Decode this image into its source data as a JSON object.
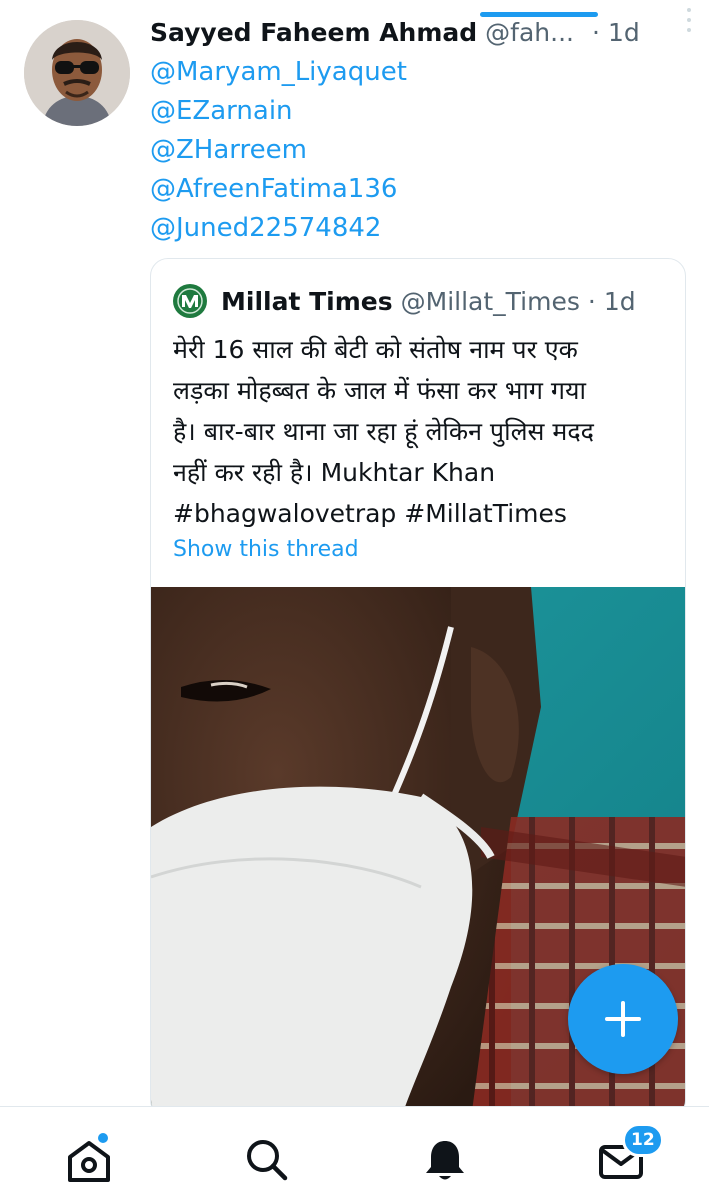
{
  "tweet": {
    "author_name": "Sayyed Faheem Ahmad",
    "author_handle": "@fah...",
    "separator": "·",
    "time": "1d",
    "mentions": [
      "@Maryam_Liyaquet",
      "@EZarnain",
      "@ZHarreem",
      "@AfreenFatima136",
      "@Juned22574842"
    ]
  },
  "quote": {
    "author_name": "Millat Times",
    "author_handle": "@Millat_Times",
    "separator": "·",
    "time": "1d",
    "text": "मेरी 16 साल की बेटी को संतोष नाम पर एक\nलड़का मोहब्बत के जाल में फंसा कर भाग गया\nहै। बार-बार थाना जा रहा हूं लेकिन पुलिस मदद\nनहीं कर रही है। Mukhtar Khan\n#bhagwalovetrap #MillatTimes",
    "show_thread": "Show this thread"
  },
  "bottom_nav": {
    "items": [
      "home-icon",
      "search-icon",
      "notifications-icon",
      "messages-icon"
    ],
    "messages_badge": "12"
  },
  "colors": {
    "accent": "#1d9bf0",
    "text": "#0f1419",
    "secondary": "#536471",
    "border": "#e1e8ed"
  }
}
